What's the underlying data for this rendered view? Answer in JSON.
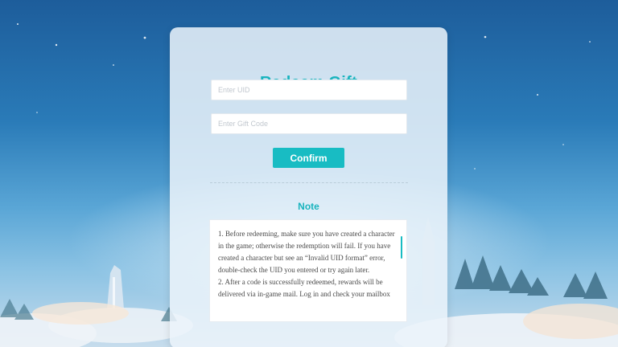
{
  "title": "Redeem Gift",
  "uid_field": {
    "placeholder": "Enter UID",
    "value": ""
  },
  "code_field": {
    "placeholder": "Enter Gift Code",
    "value": ""
  },
  "confirm_label": "Confirm",
  "note": {
    "title": "Note",
    "paragraphs": [
      "1. Before redeeming, make sure you have created a character in the game; otherwise the redemption will fail. If you have created a character but see an “Invalid UID format” error, double-check the UID you entered or try again later.",
      "2. After a code is successfully redeemed, rewards will be delivered via in-game mail. Log in and check your mailbox"
    ]
  },
  "colors": {
    "accent": "#18bcc3",
    "title": "#19b4be",
    "card": "#ebf3fa"
  }
}
